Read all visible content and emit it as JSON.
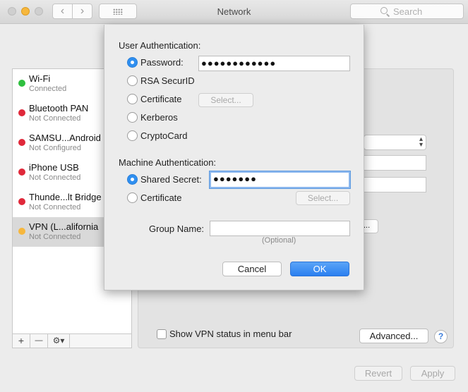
{
  "window": {
    "title": "Network",
    "back_glyph": "‹",
    "forward_glyph": "›",
    "search_placeholder": "Search"
  },
  "sidebar": {
    "items": [
      {
        "name": "Wi-Fi",
        "status": "Connected",
        "dot": "#2fbf3f"
      },
      {
        "name": "Bluetooth PAN",
        "status": "Not Connected",
        "dot": "#e0283a"
      },
      {
        "name": "SAMSU...Android",
        "status": "Not Configured",
        "dot": "#e0283a"
      },
      {
        "name": "iPhone USB",
        "status": "Not Connected",
        "dot": "#e0283a"
      },
      {
        "name": "Thunde...lt Bridge",
        "status": "Not Connected",
        "dot": "#e0283a"
      },
      {
        "name": "VPN (L...alifornia",
        "status": "Not Connected",
        "dot": "#f6b73d"
      }
    ],
    "tools": {
      "add": "+",
      "remove": "—",
      "gear": "⚙▾"
    }
  },
  "panel": {
    "show_vpn_status_label": "Show VPN status in menu bar",
    "show_vpn_status_checked": false,
    "advanced_label": "Advanced...",
    "help_label": "?",
    "hidden_button_label": "..."
  },
  "footer": {
    "revert_label": "Revert",
    "apply_label": "Apply"
  },
  "sheet": {
    "user_auth_heading": "User Authentication:",
    "user_auth_options": [
      {
        "label": "Password:",
        "selected": true
      },
      {
        "label": "RSA SecurID",
        "selected": false
      },
      {
        "label": "Certificate",
        "selected": false
      },
      {
        "label": "Kerberos",
        "selected": false
      },
      {
        "label": "CryptoCard",
        "selected": false
      }
    ],
    "password_value": "●●●●●●●●●●●●",
    "certificate_select_label": "Select...",
    "machine_auth_heading": "Machine Authentication:",
    "machine_auth_options": [
      {
        "label": "Shared Secret:",
        "selected": true
      },
      {
        "label": "Certificate",
        "selected": false
      }
    ],
    "shared_secret_value": "●●●●●●●",
    "machine_certificate_select_label": "Select...",
    "group_name_label": "Group Name:",
    "group_name_value": "",
    "group_name_hint": "(Optional)",
    "cancel_label": "Cancel",
    "ok_label": "OK",
    "accent": "#2b7ff0"
  }
}
